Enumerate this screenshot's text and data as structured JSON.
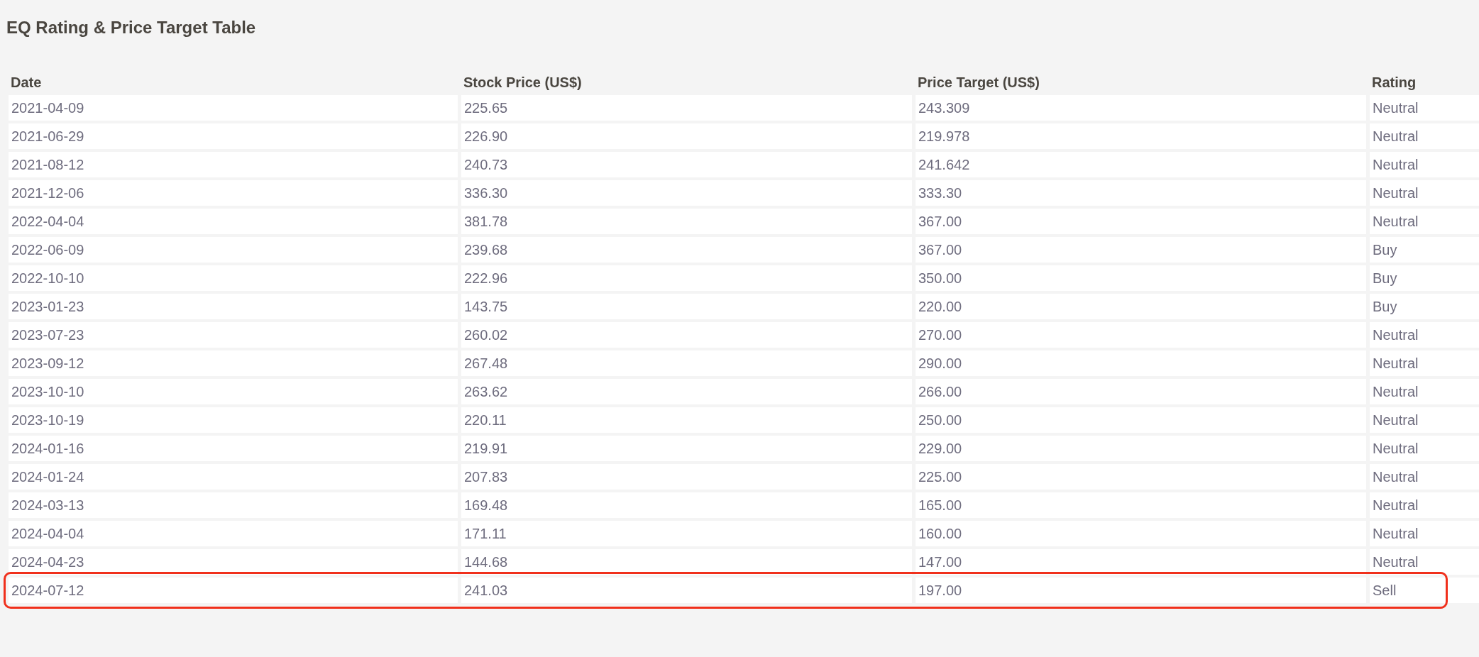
{
  "title": "EQ Rating & Price Target Table",
  "table": {
    "columns": [
      "Date",
      "Stock Price (US$)",
      "Price Target (US$)",
      "Rating"
    ],
    "rows": [
      {
        "cells": [
          "2021-04-09",
          "225.65",
          "243.309",
          "Neutral"
        ],
        "highlighted": false
      },
      {
        "cells": [
          "2021-06-29",
          "226.90",
          "219.978",
          "Neutral"
        ],
        "highlighted": false
      },
      {
        "cells": [
          "2021-08-12",
          "240.73",
          "241.642",
          "Neutral"
        ],
        "highlighted": false
      },
      {
        "cells": [
          "2021-12-06",
          "336.30",
          "333.30",
          "Neutral"
        ],
        "highlighted": false
      },
      {
        "cells": [
          "2022-04-04",
          "381.78",
          "367.00",
          "Neutral"
        ],
        "highlighted": false
      },
      {
        "cells": [
          "2022-06-09",
          "239.68",
          "367.00",
          "Buy"
        ],
        "highlighted": false
      },
      {
        "cells": [
          "2022-10-10",
          "222.96",
          "350.00",
          "Buy"
        ],
        "highlighted": false
      },
      {
        "cells": [
          "2023-01-23",
          "143.75",
          "220.00",
          "Buy"
        ],
        "highlighted": false
      },
      {
        "cells": [
          "2023-07-23",
          "260.02",
          "270.00",
          "Neutral"
        ],
        "highlighted": false
      },
      {
        "cells": [
          "2023-09-12",
          "267.48",
          "290.00",
          "Neutral"
        ],
        "highlighted": false
      },
      {
        "cells": [
          "2023-10-10",
          "263.62",
          "266.00",
          "Neutral"
        ],
        "highlighted": false
      },
      {
        "cells": [
          "2023-10-19",
          "220.11",
          "250.00",
          "Neutral"
        ],
        "highlighted": false
      },
      {
        "cells": [
          "2024-01-16",
          "219.91",
          "229.00",
          "Neutral"
        ],
        "highlighted": false
      },
      {
        "cells": [
          "2024-01-24",
          "207.83",
          "225.00",
          "Neutral"
        ],
        "highlighted": false
      },
      {
        "cells": [
          "2024-03-13",
          "169.48",
          "165.00",
          "Neutral"
        ],
        "highlighted": false
      },
      {
        "cells": [
          "2024-04-04",
          "171.11",
          "160.00",
          "Neutral"
        ],
        "highlighted": false
      },
      {
        "cells": [
          "2024-04-23",
          "144.68",
          "147.00",
          "Neutral"
        ],
        "highlighted": false
      },
      {
        "cells": [
          "2024-07-12",
          "241.03",
          "197.00",
          "Sell"
        ],
        "highlighted": true
      }
    ]
  }
}
